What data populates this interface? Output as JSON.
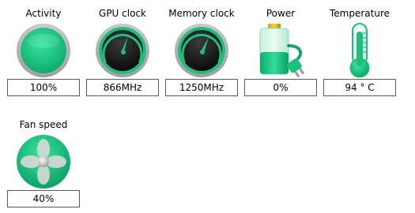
{
  "colors": {
    "accent": "#1ebf7c",
    "accent_dark": "#0a8a57",
    "dial_face": "#1a1a1a",
    "bezel": "#bcbcbc"
  },
  "tiles": [
    {
      "label": "Activity",
      "value": "100%",
      "icon": "activity-dial-icon",
      "level_percent": 100
    },
    {
      "label": "GPU clock",
      "value": "866MHz",
      "icon": "gpu-clock-gauge-icon"
    },
    {
      "label": "Memory clock",
      "value": "1250MHz",
      "icon": "memory-clock-gauge-icon"
    },
    {
      "label": "Power",
      "value": "0%",
      "icon": "battery-plug-icon"
    },
    {
      "label": "Temperature",
      "value": "94 ° C",
      "icon": "thermometer-icon"
    },
    {
      "label": "Fan speed",
      "value": "40%",
      "icon": "fan-icon"
    }
  ]
}
